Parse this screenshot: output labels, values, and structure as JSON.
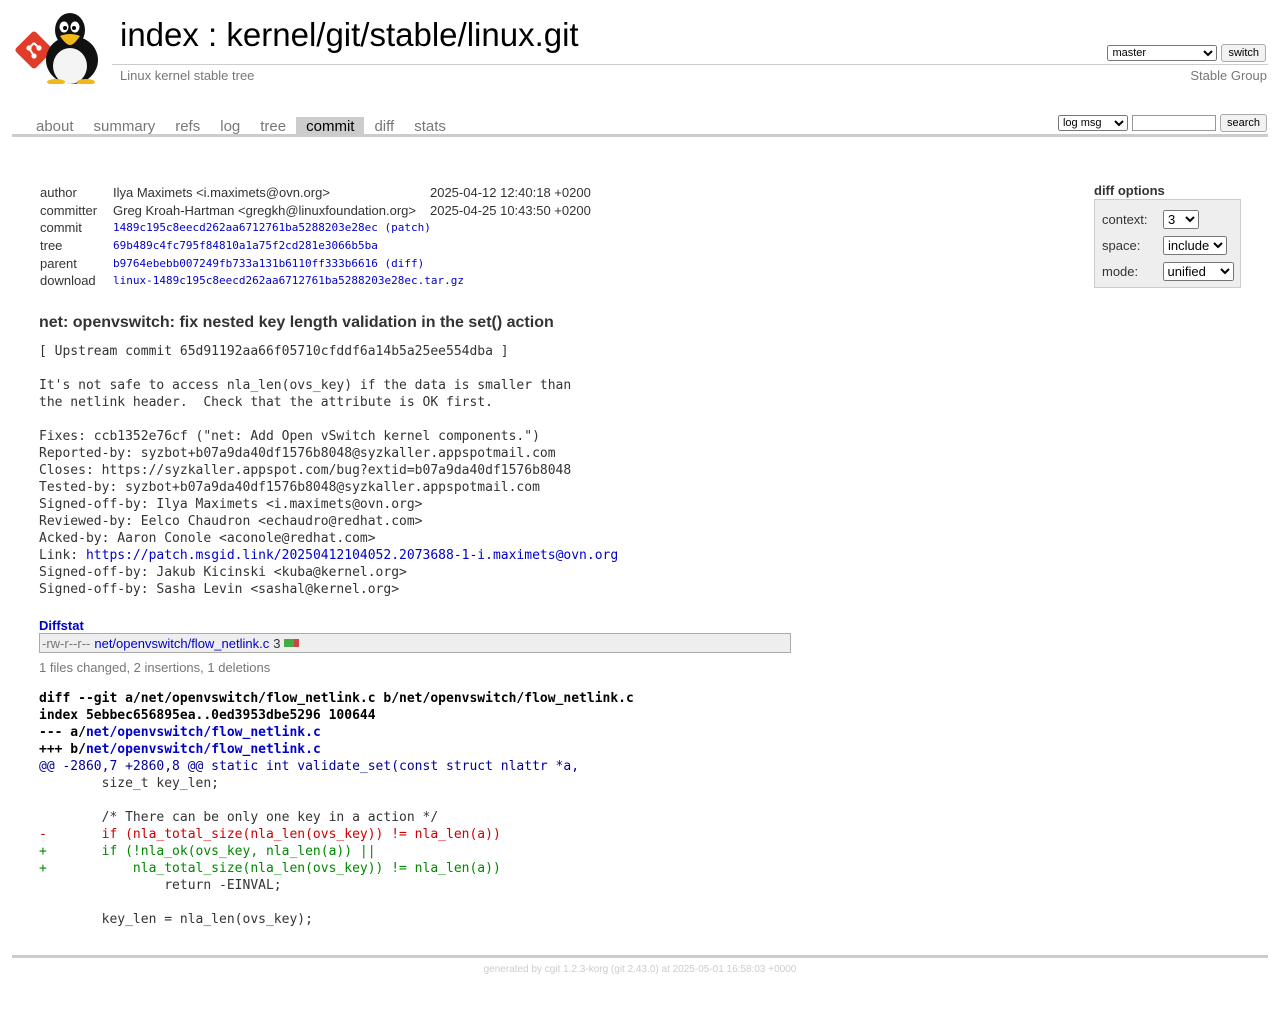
{
  "header": {
    "title_index": "index",
    "title_sep": " : ",
    "title_repo": "kernel/git/stable/linux.git",
    "subtitle": "Linux kernel stable tree",
    "owner": "Stable Group",
    "branch_selected": "master",
    "switch_label": "switch"
  },
  "tabs": [
    {
      "label": "about"
    },
    {
      "label": "summary"
    },
    {
      "label": "refs"
    },
    {
      "label": "log"
    },
    {
      "label": "tree"
    },
    {
      "label": "commit",
      "active": true
    },
    {
      "label": "diff"
    },
    {
      "label": "stats"
    }
  ],
  "search": {
    "mode_selected": "log msg",
    "query": "",
    "button_label": "search"
  },
  "diff_options": {
    "title": "diff options",
    "context_label": "context:",
    "context_value": "3",
    "space_label": "space:",
    "space_value": "include",
    "mode_label": "mode:",
    "mode_value": "unified"
  },
  "commit_info": {
    "author_label": "author",
    "author": "Ilya Maximets <i.maximets@ovn.org>",
    "author_date": "2025-04-12 12:40:18 +0200",
    "committer_label": "committer",
    "committer": "Greg Kroah-Hartman <gregkh@linuxfoundation.org>",
    "committer_date": "2025-04-25 10:43:50 +0200",
    "commit_label": "commit",
    "commit": "1489c195c8eecd262aa6712761ba5288203e28ec",
    "patch_link": "(patch)",
    "tree_label": "tree",
    "tree": "69b489c4fc795f84810a1a75f2cd281e3066b5ba",
    "parent_label": "parent",
    "parent": "b9764ebebb007249fb733a131b6110ff333b6616",
    "diff_link": "(diff)",
    "download_label": "download",
    "download": "linux-1489c195c8eecd262aa6712761ba5288203e28ec.tar.gz"
  },
  "subject": "net: openvswitch: fix nested key length validation in the set() action",
  "message": {
    "before_link": "[ Upstream commit 65d91192aa66f05710cfddf6a14b5a25ee554dba ]\n\nIt's not safe to access nla_len(ovs_key) if the data is smaller than\nthe netlink header.  Check that the attribute is OK first.\n\nFixes: ccb1352e76cf (\"net: Add Open vSwitch kernel components.\")\nReported-by: syzbot+b07a9da40df1576b8048@syzkaller.appspotmail.com\nCloses: https://syzkaller.appspot.com/bug?extid=b07a9da40df1576b8048\nTested-by: syzbot+b07a9da40df1576b8048@syzkaller.appspotmail.com\nSigned-off-by: Ilya Maximets <i.maximets@ovn.org>\nReviewed-by: Eelco Chaudron <echaudro@redhat.com>\nAcked-by: Aaron Conole <aconole@redhat.com>\nLink: ",
    "link": "https://patch.msgid.link/20250412104052.2073688-1-i.maximets@ovn.org",
    "after_link": "\nSigned-off-by: Jakub Kicinski <kuba@kernel.org>\nSigned-off-by: Sasha Levin <sashal@kernel.org>"
  },
  "diffstat": {
    "header": "Diffstat",
    "mode": "-rw-r--r--",
    "file": "net/openvswitch/flow_netlink.c",
    "count": "3",
    "insertions": 2,
    "deletions": 1,
    "summary": "1 files changed, 2 insertions, 1 deletions"
  },
  "diff": {
    "cmd": "diff --git a/net/openvswitch/flow_netlink.c b/net/openvswitch/flow_netlink.c",
    "index": "index 5ebbec656895ea..0ed3953dbe5296 100644",
    "old_prefix": "--- a/",
    "old_path": "net/openvswitch/flow_netlink.c",
    "new_prefix": "+++ b/",
    "new_path": "net/openvswitch/flow_netlink.c",
    "hunk": "@@ -2860,7 +2860,8 @@ static int validate_set(const struct nlattr *a,",
    "lines": [
      {
        "type": "ctx",
        "text": "        size_t key_len;"
      },
      {
        "type": "ctx",
        "text": ""
      },
      {
        "type": "ctx",
        "text": "        /* There can be only one key in a action */"
      },
      {
        "type": "del",
        "text": "-       if (nla_total_size(nla_len(ovs_key)) != nla_len(a))"
      },
      {
        "type": "add",
        "text": "+       if (!nla_ok(ovs_key, nla_len(a)) ||"
      },
      {
        "type": "add",
        "text": "+           nla_total_size(nla_len(ovs_key)) != nla_len(a))"
      },
      {
        "type": "ctx",
        "text": "                return -EINVAL;"
      },
      {
        "type": "ctx",
        "text": ""
      },
      {
        "type": "ctx",
        "text": "        key_len = nla_len(ovs_key);"
      }
    ]
  },
  "footer": "generated by cgit 1.2.3-korg (git 2.43.0) at 2025-05-01 16:58:03 +0000",
  "colors": {
    "link": "#0000cc",
    "added": "#008800",
    "deleted": "#cc0000",
    "hunk": "#000099"
  }
}
